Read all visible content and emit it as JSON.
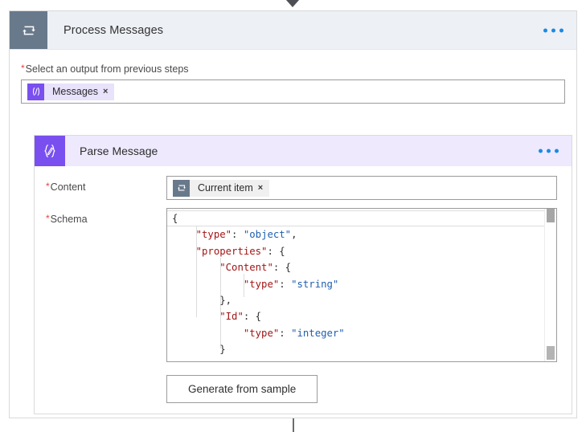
{
  "connector": {
    "top_arrow_icon": "chevron-down-arrowhead",
    "bottom_line": "vertical-connector-line"
  },
  "outer_action": {
    "icon": "loop-repeat-icon",
    "title": "Process Messages",
    "menu_icon": "ellipsis-horizontal-icon",
    "icon_bg": "#69798c",
    "header_bg": "#edf0f4",
    "field": {
      "required": true,
      "required_marker": "*",
      "label": "Select an output from previous steps",
      "token": {
        "icon": "expression-code-icon",
        "icon_glyph": "⟨/⟩",
        "icon_bg": "#7a4ff0",
        "label": "Messages",
        "remove_label": "×",
        "chip_bg": "#e9e2fb"
      }
    }
  },
  "inner_action": {
    "icon": "parse-json-braces-pencil-icon",
    "title": "Parse Message",
    "menu_icon": "ellipsis-horizontal-icon",
    "icon_bg": "#7a4ff0",
    "header_bg": "#eee9fd",
    "content_field": {
      "required": true,
      "required_marker": "*",
      "label": "Content",
      "token": {
        "icon": "loop-current-item-icon",
        "icon_bg": "#69798c",
        "label": "Current item",
        "remove_label": "×",
        "chip_bg": "#f0f0f0"
      }
    },
    "schema_field": {
      "required": true,
      "required_marker": "*",
      "label": "Schema",
      "editor": {
        "language": "json",
        "colors": {
          "key": "#a31515",
          "value": "#1f5fb0",
          "punctuation": "#2f2f2f"
        },
        "scrollbar": {
          "visible": true,
          "thumb_color": "#a6a6a6"
        },
        "lines": [
          {
            "indent": 0,
            "parts": [
              {
                "t": "{",
                "c": "pun"
              }
            ],
            "active": true
          },
          {
            "indent": 1,
            "parts": [
              {
                "t": "\"type\"",
                "c": "key"
              },
              {
                "t": ": ",
                "c": "pun"
              },
              {
                "t": "\"object\"",
                "c": "val"
              },
              {
                "t": ",",
                "c": "pun"
              }
            ]
          },
          {
            "indent": 1,
            "parts": [
              {
                "t": "\"properties\"",
                "c": "key"
              },
              {
                "t": ": {",
                "c": "pun"
              }
            ]
          },
          {
            "indent": 2,
            "parts": [
              {
                "t": "\"Content\"",
                "c": "key"
              },
              {
                "t": ": {",
                "c": "pun"
              }
            ]
          },
          {
            "indent": 3,
            "parts": [
              {
                "t": "\"type\"",
                "c": "key"
              },
              {
                "t": ": ",
                "c": "pun"
              },
              {
                "t": "\"string\"",
                "c": "val"
              }
            ]
          },
          {
            "indent": 2,
            "parts": [
              {
                "t": "},",
                "c": "pun"
              }
            ]
          },
          {
            "indent": 2,
            "parts": [
              {
                "t": "\"Id\"",
                "c": "key"
              },
              {
                "t": ": {",
                "c": "pun"
              }
            ]
          },
          {
            "indent": 3,
            "parts": [
              {
                "t": "\"type\"",
                "c": "key"
              },
              {
                "t": ": ",
                "c": "pun"
              },
              {
                "t": "\"integer\"",
                "c": "val"
              }
            ]
          },
          {
            "indent": 2,
            "parts": [
              {
                "t": "}",
                "c": "pun"
              }
            ]
          },
          {
            "indent": 1,
            "parts": [
              {
                "t": "}",
                "c": "pun"
              }
            ]
          }
        ],
        "raw_text": "{\n    \"type\": \"object\",\n    \"properties\": {\n        \"Content\": {\n            \"type\": \"string\"\n        },\n        \"Id\": {\n            \"type\": \"integer\"\n        }\n    }"
      }
    },
    "generate_button": {
      "label": "Generate from sample"
    }
  }
}
